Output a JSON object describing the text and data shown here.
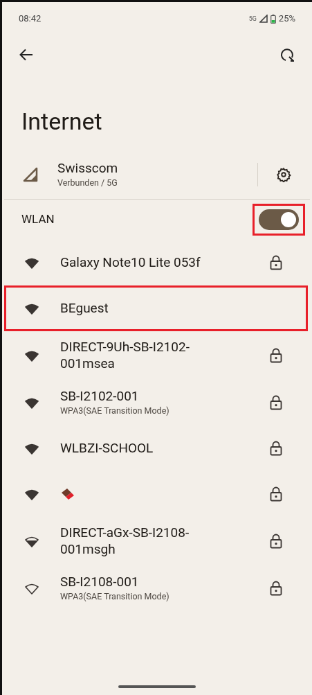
{
  "status_bar": {
    "time": "08:42",
    "network": "5G",
    "battery": "25%"
  },
  "title": "Internet",
  "mobile": {
    "name": "Swisscom",
    "status": "Verbunden / 5G"
  },
  "wlan": {
    "label": "WLAN",
    "on": true,
    "highlighted": true
  },
  "networks": [
    {
      "kind": "full",
      "name": "Galaxy Note10 Lite 053f",
      "secured": true,
      "highlighted": false
    },
    {
      "kind": "high",
      "name": "BEguest",
      "secured": false,
      "highlighted": true
    },
    {
      "kind": "high",
      "name": "DIRECT-9Uh-SB-I2102-001msea",
      "secured": true,
      "highlighted": false
    },
    {
      "kind": "high",
      "name": "SB-I2102-001",
      "detail": "WPA3(SAE Transition Mode)",
      "secured": true,
      "highlighted": false
    },
    {
      "kind": "full",
      "name": "WLBZI-SCHOOL",
      "secured": true,
      "highlighted": false
    },
    {
      "kind": "high",
      "secured": true,
      "highlighted": false
    },
    {
      "kind": "medium",
      "name": "DIRECT-aGx-SB-I2108-001msgh",
      "secured": true,
      "highlighted": false
    },
    {
      "kind": "low",
      "name": "SB-I2108-001",
      "detail": "WPA3(SAE Transition Mode)",
      "secured": true,
      "highlighted": false
    }
  ]
}
